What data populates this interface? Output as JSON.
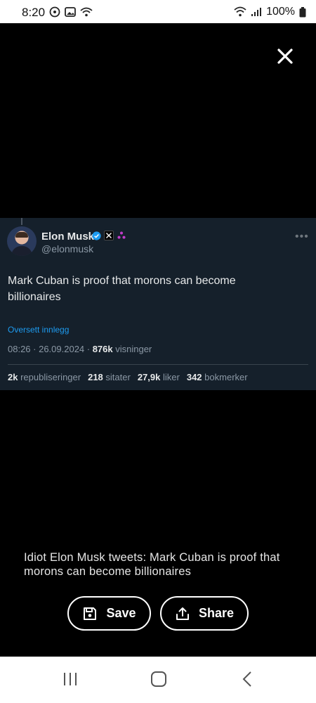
{
  "status_bar": {
    "time": "8:20",
    "battery": "100%"
  },
  "tweet": {
    "author_name": "Elon Musk",
    "author_handle": "@elonmusk",
    "text": "Mark Cuban is proof that morons can become billionaires",
    "translate_label": "Oversett innlegg",
    "time": "08:26 · 26.09.2024 · ",
    "views_count": "876k",
    "views_label": " visninger",
    "stats": [
      {
        "count": "2k",
        "label": "republiseringer"
      },
      {
        "count": "218",
        "label": "sitater"
      },
      {
        "count": "27,9k",
        "label": "liker"
      },
      {
        "count": "342",
        "label": "bokmerker"
      }
    ]
  },
  "caption": "Idiot Elon Musk tweets: Mark Cuban is proof that morons can become billionaires",
  "actions": {
    "save_label": "Save",
    "share_label": "Share"
  },
  "colors": {
    "tweet_bg": "#15202b",
    "link": "#1d9bf0",
    "verified": "#1d9bf0"
  }
}
